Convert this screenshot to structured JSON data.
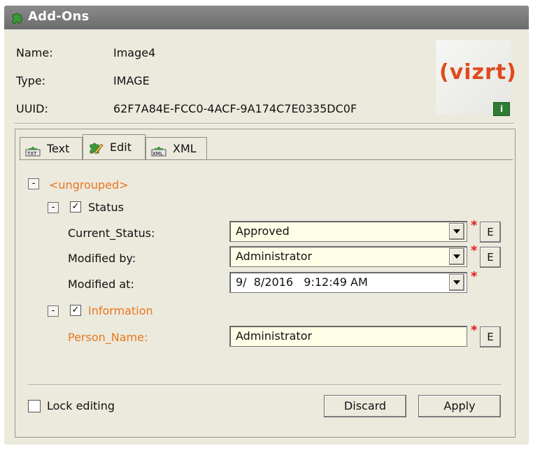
{
  "window": {
    "title": "Add-Ons"
  },
  "info": {
    "name_label": "Name:",
    "name_value": "Image4",
    "type_label": "Type:",
    "type_value": "IMAGE",
    "uuid_label": "UUID:",
    "uuid_value": "62F7A84E-FCC0-4ACF-9A174C7E0335DC0F",
    "logo_text": "vizrt",
    "badge_text": "i"
  },
  "tabs": [
    {
      "label": "Text",
      "icon": "text-tab-icon",
      "icon_text": "TXT"
    },
    {
      "label": "Edit",
      "icon": "edit-pencil-icon"
    },
    {
      "label": "XML",
      "icon": "xml-tab-icon",
      "icon_text": "XML"
    }
  ],
  "tree": {
    "root_expander": "-",
    "root_label": "<ungrouped>",
    "status_group": {
      "expander": "-",
      "checked": true,
      "label": "Status",
      "fields": [
        {
          "label": "Current_Status:",
          "value": "Approved",
          "required": "*",
          "edit_label": "E"
        },
        {
          "label": "Modified by:",
          "value": "Administrator",
          "required": "*",
          "edit_label": "E"
        },
        {
          "label": "Modified at:",
          "value": "9/  8/2016   9:12:49 AM",
          "required": "*"
        }
      ]
    },
    "information_group": {
      "expander": "-",
      "checked": true,
      "label": "Information",
      "fields": [
        {
          "label": "Person_Name:",
          "value": "Administrator",
          "required": "*",
          "edit_label": "E"
        }
      ]
    }
  },
  "footer": {
    "lock_label": "Lock editing",
    "lock_checked": false,
    "discard_label": "Discard",
    "apply_label": "Apply"
  },
  "colors": {
    "accent_orange": "#e8771d",
    "required_red": "#e01b1b",
    "titlebar": "#7a7a7a",
    "window_bg": "#ece9dd",
    "field_bg": "#fffee6",
    "logo": "#e04a1e",
    "vizrt_green": "#2e7d32"
  }
}
